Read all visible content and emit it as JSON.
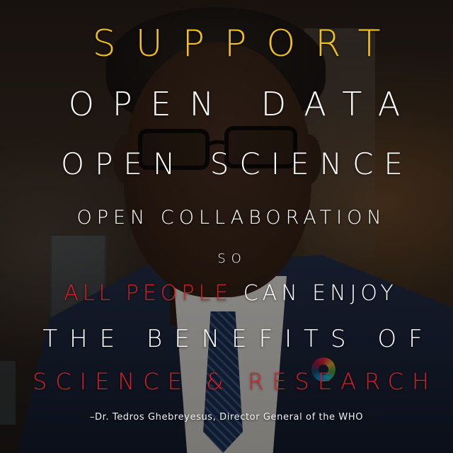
{
  "poster": {
    "support": "SUPPORT",
    "open_data": "OPEN DATA",
    "open_science_1": "OPEN",
    "open_science_2": "SCIENCE",
    "open_collaboration": "OPEN COLLABORATION",
    "so": "SO",
    "all_people": "ALL PEOPLE",
    "can_enjoy": "CAN ENJOY",
    "benefits": "THE BENEFITS OF",
    "science_research": "SCIENCE & RESEARCH",
    "attribution": "–Dr. Tedros Ghebreyesus, Director General of the WHO"
  },
  "colors": {
    "accent_yellow": "#f2c21b",
    "accent_red": "#d91f26",
    "text_white": "#ffffff"
  },
  "icons": {
    "lapel_pin": "sdg-wheel-pin-icon"
  }
}
